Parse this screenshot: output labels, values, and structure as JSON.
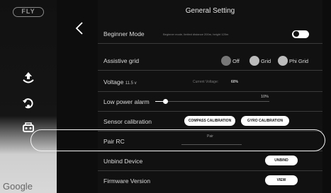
{
  "brand": {
    "logo_text": "FLY"
  },
  "map": {
    "attribution": "Google"
  },
  "left_rail": {
    "icons": [
      "takeoff-icon",
      "return-home-icon",
      "aircraft-settings-icon"
    ]
  },
  "panel": {
    "title": "General Setting",
    "rows": {
      "beginner_mode": {
        "label": "Beginner Mode",
        "note": "Beginner mode, limited distance 200m, height 120m",
        "enabled": false
      },
      "assistive_grid": {
        "label": "Assistive grid",
        "options": [
          "Off",
          "Grid",
          "Phi Grid"
        ],
        "selected": "Off"
      },
      "voltage": {
        "label": "Voltage",
        "value": "11.5 v",
        "current_label": "Current Voltage:",
        "current_value": "60%"
      },
      "low_power_alarm": {
        "label": "Low power alarm",
        "value": "10%",
        "level": 0.1
      },
      "sensor_calibration": {
        "label": "Sensor calibration",
        "compass_button": "COMPASS CALIBRATION",
        "gyro_button": "GYRO CALIBRATION"
      },
      "pair_rc": {
        "label": "Pair RC",
        "hint": "Pair"
      },
      "unbind_device": {
        "label": "Unbind Device",
        "button": "UNBIND"
      },
      "firmware_version": {
        "label": "Firmware Version",
        "button": "VIEW"
      }
    }
  },
  "colors": {
    "panel_bg": "#111111",
    "highlight": "#f4f4f4"
  }
}
